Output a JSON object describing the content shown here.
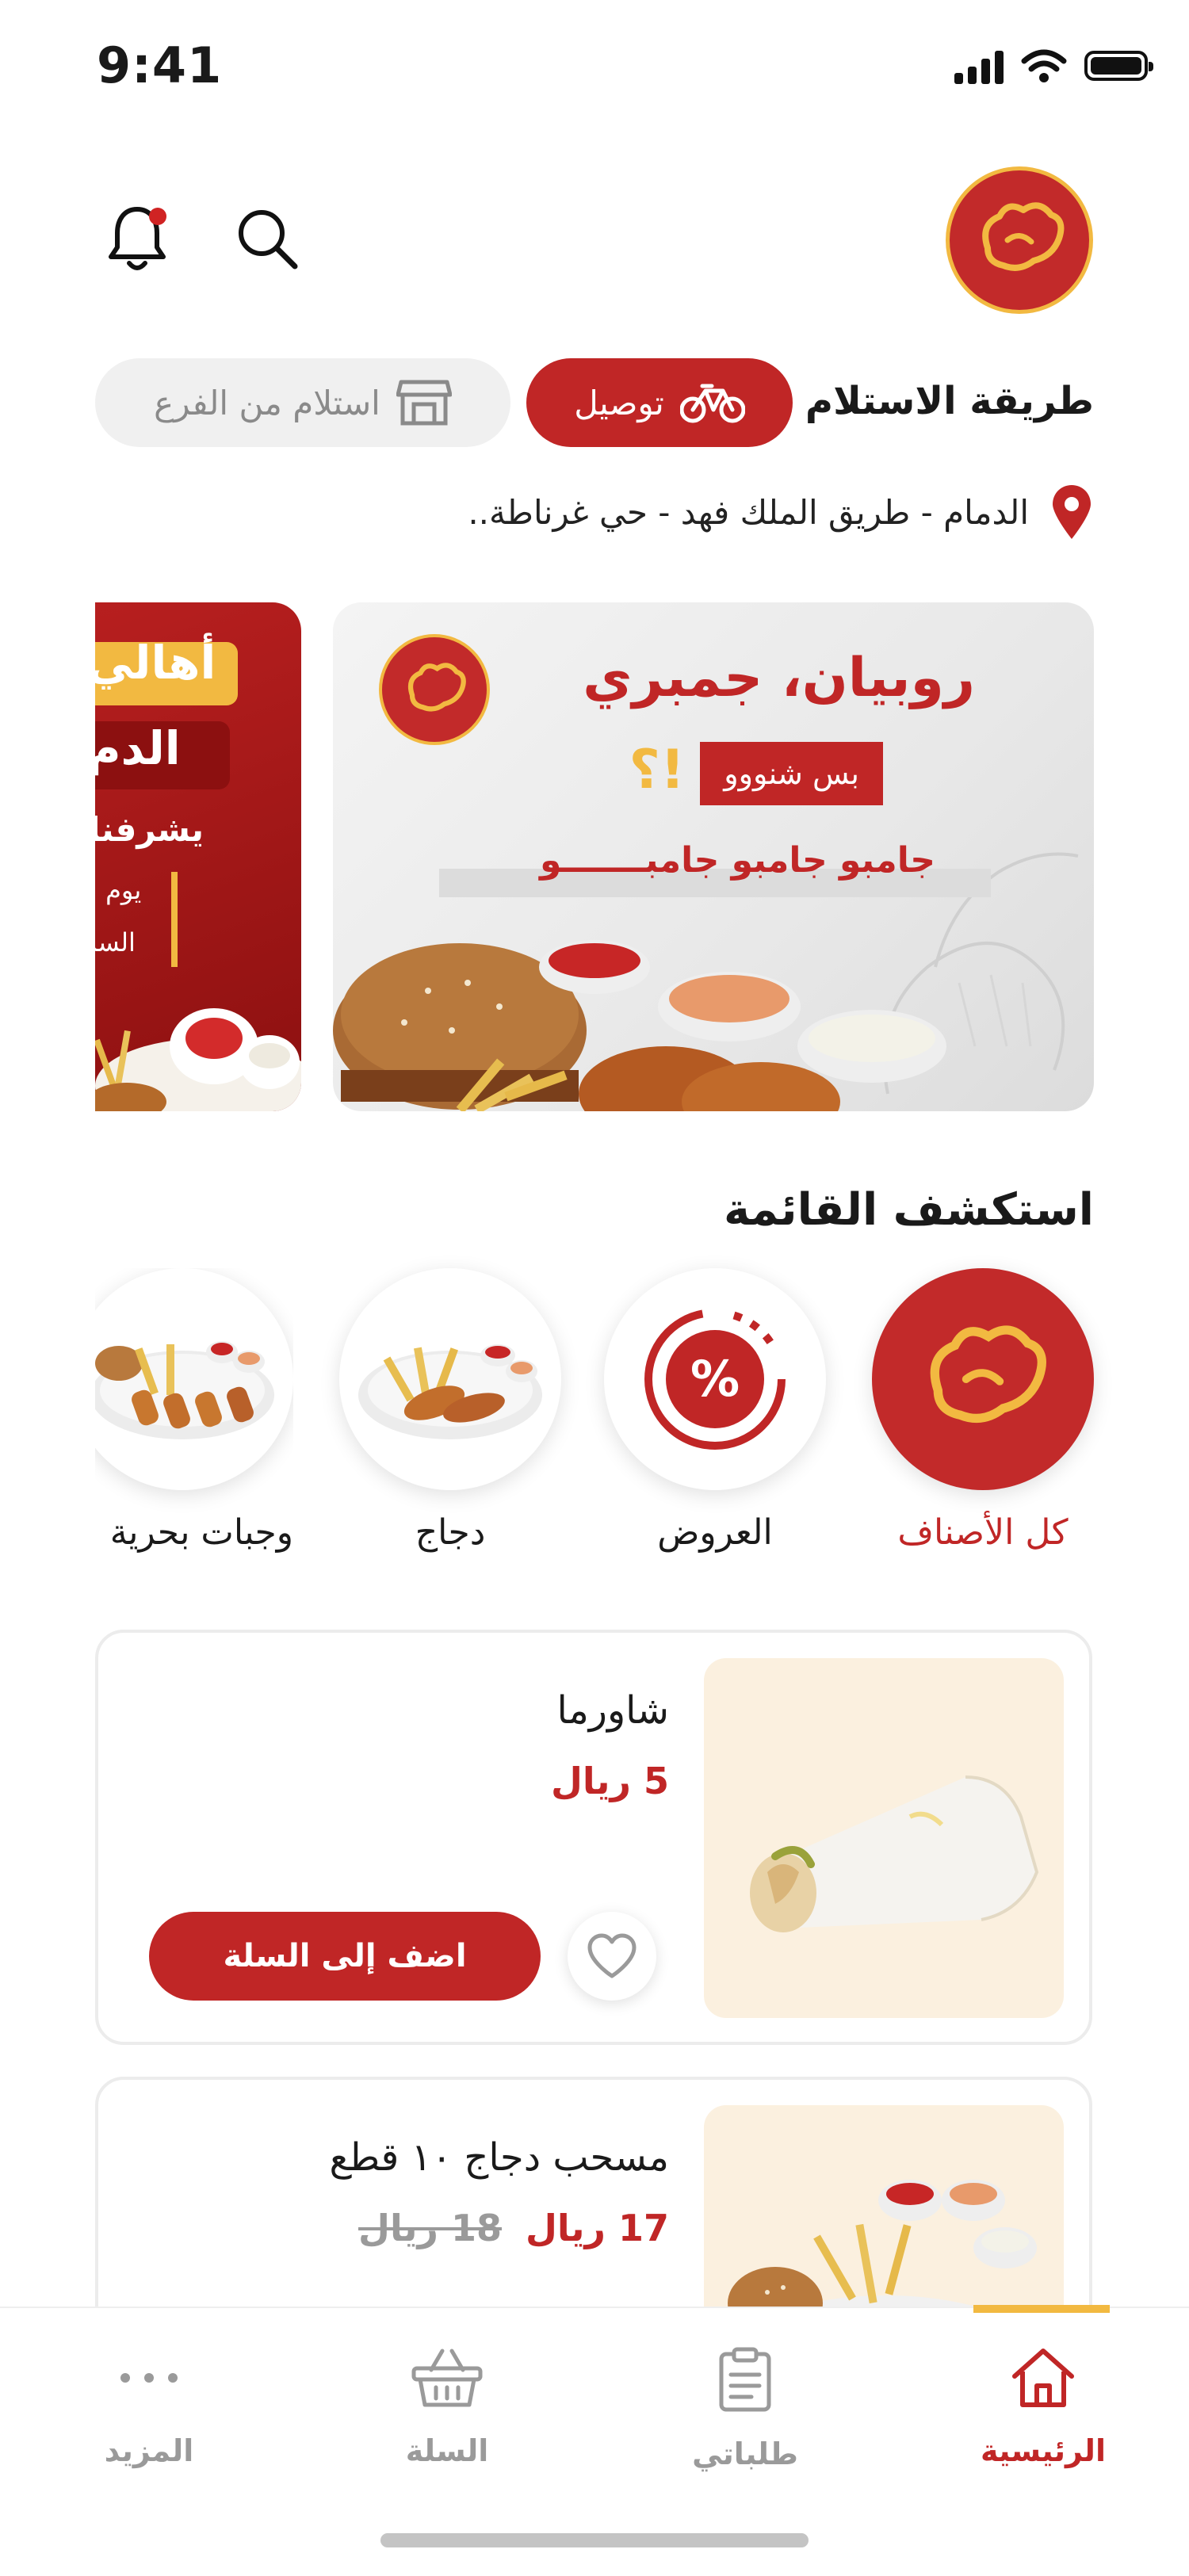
{
  "status_bar": {
    "time": "9:41"
  },
  "header": {
    "logo_text": "مطاعم كوفة",
    "has_notification": true
  },
  "pickup": {
    "label": "طريقة الاستلام",
    "options": [
      {
        "label": "توصيل",
        "active": true,
        "icon": "bicycle-icon"
      },
      {
        "label": "استلام من الفرع",
        "active": false,
        "icon": "store-icon"
      }
    ]
  },
  "address": {
    "text": "الدمام - طريق الملك فهد - حي غرناطة.."
  },
  "banners": {
    "main": {
      "title": "روبيان، جمبري",
      "tag": "بس شنووو",
      "tag_mark": "؟!",
      "subtitle": "جامبو جامبو جامبـــــــو",
      "logo_text": "مطاعم كوفة"
    },
    "side": {
      "line1": "أهالي",
      "line2": "الدم",
      "line3": "يشرفنا",
      "line4": "يوم ا",
      "line5": "السا"
    }
  },
  "menu": {
    "title": "استكشف القائمة",
    "categories": [
      {
        "label": "كل الأصناف",
        "active": true,
        "icon": "logo-icon"
      },
      {
        "label": "العروض",
        "active": false,
        "icon": "percent-icon"
      },
      {
        "label": "دجاج",
        "active": false,
        "icon": "chicken-meal-image"
      },
      {
        "label": "وجبات بحرية",
        "active": false,
        "icon": "seafood-meal-image"
      }
    ]
  },
  "products": [
    {
      "name": "شاورما",
      "price": "5 ريال",
      "old_price": "",
      "add_label": "اضف إلى السلة"
    },
    {
      "name": "مسحب دجاج ١٠ قطع",
      "price": "17 ريال",
      "old_price": "18 ريال",
      "add_label": "اضف إلى السلة"
    }
  ],
  "bottom_nav": [
    {
      "label": "الرئيسية",
      "active": true,
      "icon": "home-icon"
    },
    {
      "label": "طلباتي",
      "active": false,
      "icon": "orders-icon"
    },
    {
      "label": "السلة",
      "active": false,
      "icon": "basket-icon"
    },
    {
      "label": "المزيد",
      "active": false,
      "icon": "more-icon"
    }
  ],
  "colors": {
    "primary": "#c02626",
    "accent": "#f2b941",
    "muted": "#9a9a9a"
  }
}
